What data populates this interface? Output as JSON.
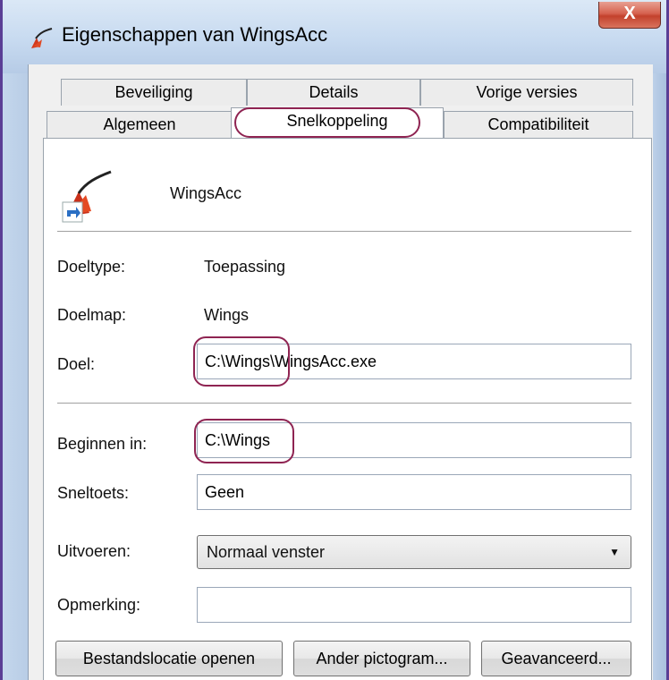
{
  "window": {
    "title": "Eigenschappen van WingsAcc",
    "close_label": "X"
  },
  "tabs": {
    "row1": [
      "Beveiliging",
      "Details",
      "Vorige versies"
    ],
    "row2": [
      "Algemeen",
      "Snelkoppeling",
      "Compatibiliteit"
    ],
    "active": "Snelkoppeling"
  },
  "app": {
    "name": "WingsAcc",
    "icon": "wings-app-icon"
  },
  "fields": {
    "doeltype_label": "Doeltype:",
    "doeltype_value": "Toepassing",
    "doelmap_label": "Doelmap:",
    "doelmap_value": "Wings",
    "doel_label": "Doel:",
    "doel_value": "C:\\Wings\\WingsAcc.exe",
    "beginnen_label": "Beginnen in:",
    "beginnen_value": "C:\\Wings",
    "sneltoets_label": "Sneltoets:",
    "sneltoets_value": "Geen",
    "uitvoeren_label": "Uitvoeren:",
    "uitvoeren_value": "Normaal venster",
    "opmerking_label": "Opmerking:",
    "opmerking_value": ""
  },
  "buttons": {
    "open_location": "Bestandslocatie openen",
    "change_icon": "Ander pictogram...",
    "advanced": "Geavanceerd..."
  },
  "colors": {
    "highlight": "#8f2452",
    "frame": "#5a3e95",
    "close": "#c3412c"
  }
}
